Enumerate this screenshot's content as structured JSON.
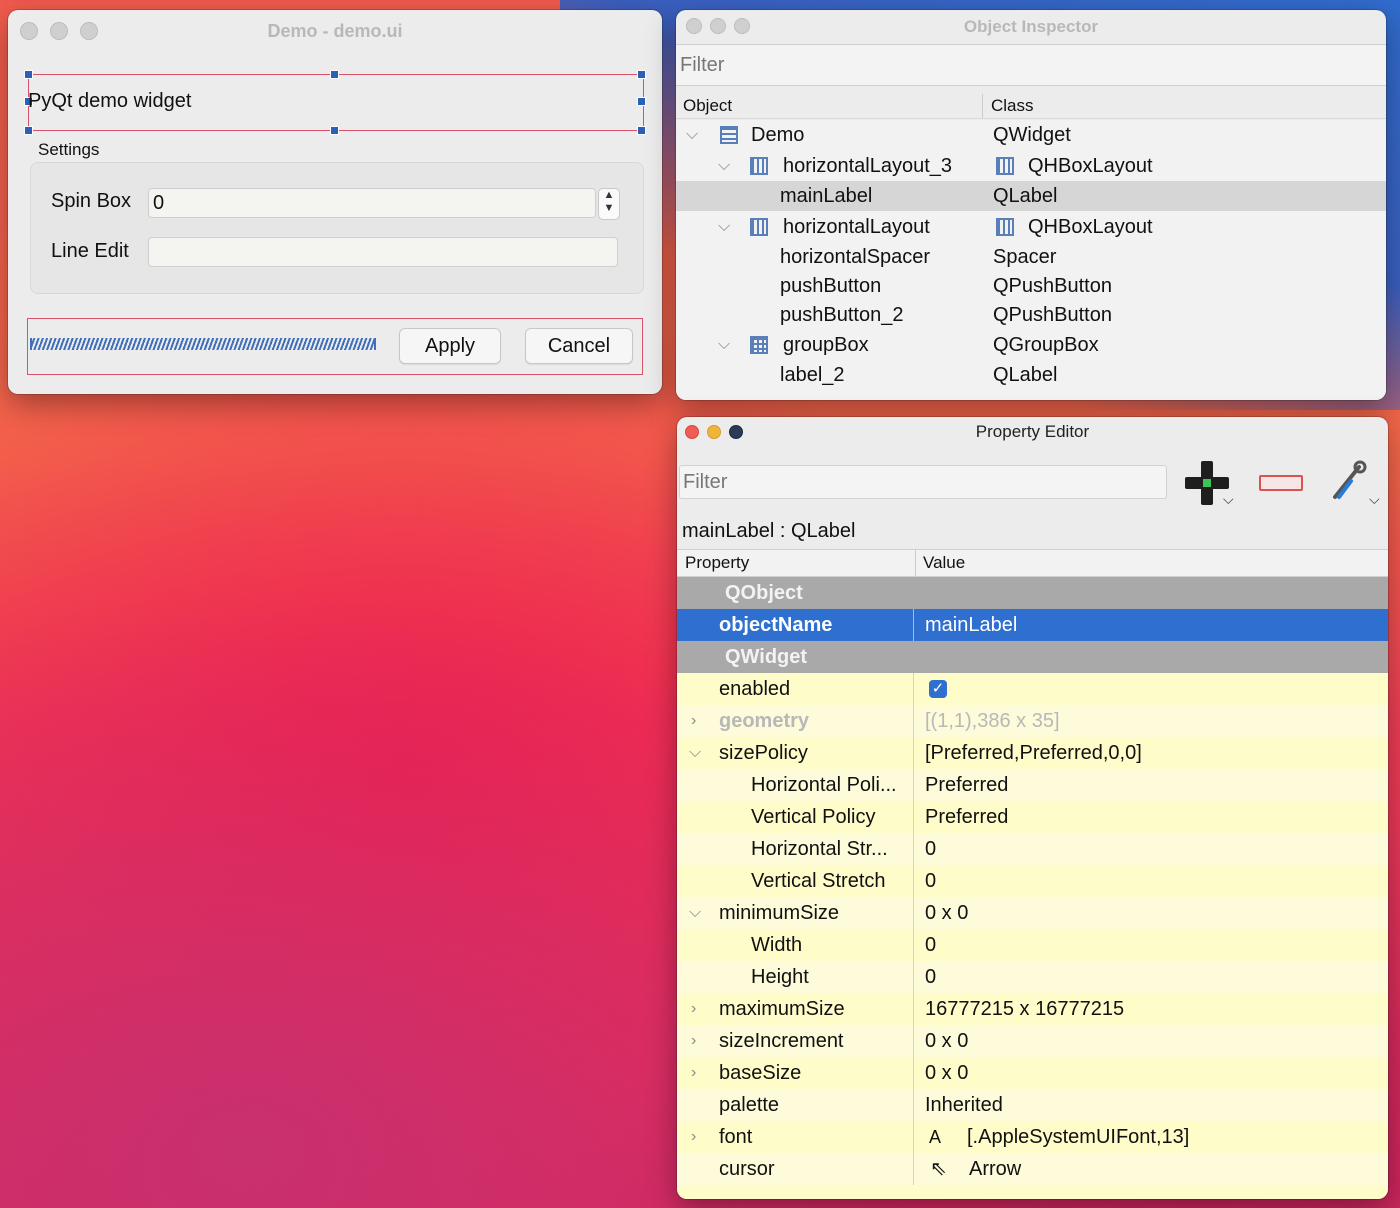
{
  "demo": {
    "title": "Demo - demo.ui",
    "main_label": "PyQt demo widget",
    "groupbox_title": "Settings",
    "spin_label": "Spin Box",
    "spin_value": "0",
    "line_label": "Line Edit",
    "line_value": "",
    "apply": "Apply",
    "cancel": "Cancel"
  },
  "inspector": {
    "title": "Object Inspector",
    "filter_placeholder": "Filter",
    "col_object": "Object",
    "col_class": "Class",
    "rows": [
      {
        "object": "Demo",
        "class": "QWidget"
      },
      {
        "object": "horizontalLayout_3",
        "class": "QHBoxLayout"
      },
      {
        "object": "mainLabel",
        "class": "QLabel"
      },
      {
        "object": "horizontalLayout",
        "class": "QHBoxLayout"
      },
      {
        "object": "horizontalSpacer",
        "class": "Spacer"
      },
      {
        "object": "pushButton",
        "class": "QPushButton"
      },
      {
        "object": "pushButton_2",
        "class": "QPushButton"
      },
      {
        "object": "groupBox",
        "class": "QGroupBox"
      },
      {
        "object": "label_2",
        "class": "QLabel"
      }
    ]
  },
  "props": {
    "title": "Property Editor",
    "filter_placeholder": "Filter",
    "current": "mainLabel : QLabel",
    "col_property": "Property",
    "col_value": "Value",
    "rows": [
      {
        "name": "QObject",
        "value": ""
      },
      {
        "name": "objectName",
        "value": "mainLabel"
      },
      {
        "name": "QWidget",
        "value": ""
      },
      {
        "name": "enabled",
        "value": ""
      },
      {
        "name": "geometry",
        "value": "[(1,1),386 x 35]"
      },
      {
        "name": "sizePolicy",
        "value": "[Preferred,Preferred,0,0]"
      },
      {
        "name": "Horizontal Poli...",
        "value": "Preferred"
      },
      {
        "name": "Vertical Policy",
        "value": "Preferred"
      },
      {
        "name": "Horizontal Str...",
        "value": "0"
      },
      {
        "name": "Vertical Stretch",
        "value": "0"
      },
      {
        "name": "minimumSize",
        "value": "0 x 0"
      },
      {
        "name": "Width",
        "value": "0"
      },
      {
        "name": "Height",
        "value": "0"
      },
      {
        "name": "maximumSize",
        "value": "16777215 x 16777215"
      },
      {
        "name": "sizeIncrement",
        "value": "0 x 0"
      },
      {
        "name": "baseSize",
        "value": "0 x 0"
      },
      {
        "name": "palette",
        "value": "Inherited"
      },
      {
        "name": "font",
        "value": "[.AppleSystemUIFont,13]"
      },
      {
        "name": "cursor",
        "value": "Arrow"
      }
    ],
    "font_glyph": "A"
  },
  "colors": {
    "selection_blue": "#2f6fd0",
    "property_yellow": "#fefcc8",
    "group_grey": "#a9a9a9"
  }
}
